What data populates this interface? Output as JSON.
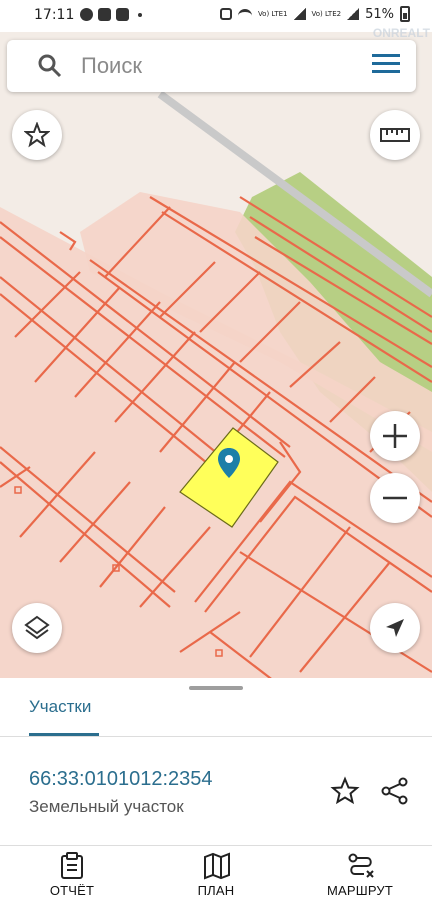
{
  "status_bar": {
    "time": "17:11",
    "network1": "Vo) LTE1",
    "network2": "Vo) LTE2",
    "battery": "51%"
  },
  "search": {
    "placeholder": "Поиск"
  },
  "watermark": "ONREALT",
  "map": {
    "marker_icon": "location-pin-icon",
    "buttons": [
      "star-icon",
      "ruler-icon",
      "zoom-in-icon",
      "zoom-out-icon",
      "layers-icon",
      "navigation-arrow-icon"
    ]
  },
  "sheet": {
    "tab_label": "Участки",
    "cadastral_number": "66:33:0101012:2354",
    "object_type": "Земельный участок"
  },
  "bottom_nav": {
    "report": "ОТЧЁТ",
    "plan": "ПЛАН",
    "route": "МАРШРУТ"
  },
  "colors": {
    "accent": "#2b6e8e",
    "parcel_line": "#e9694a",
    "parcel_fill": "#f5d4c8",
    "selected_parcel": "#ffff5a",
    "forest": "#b7cf84"
  }
}
